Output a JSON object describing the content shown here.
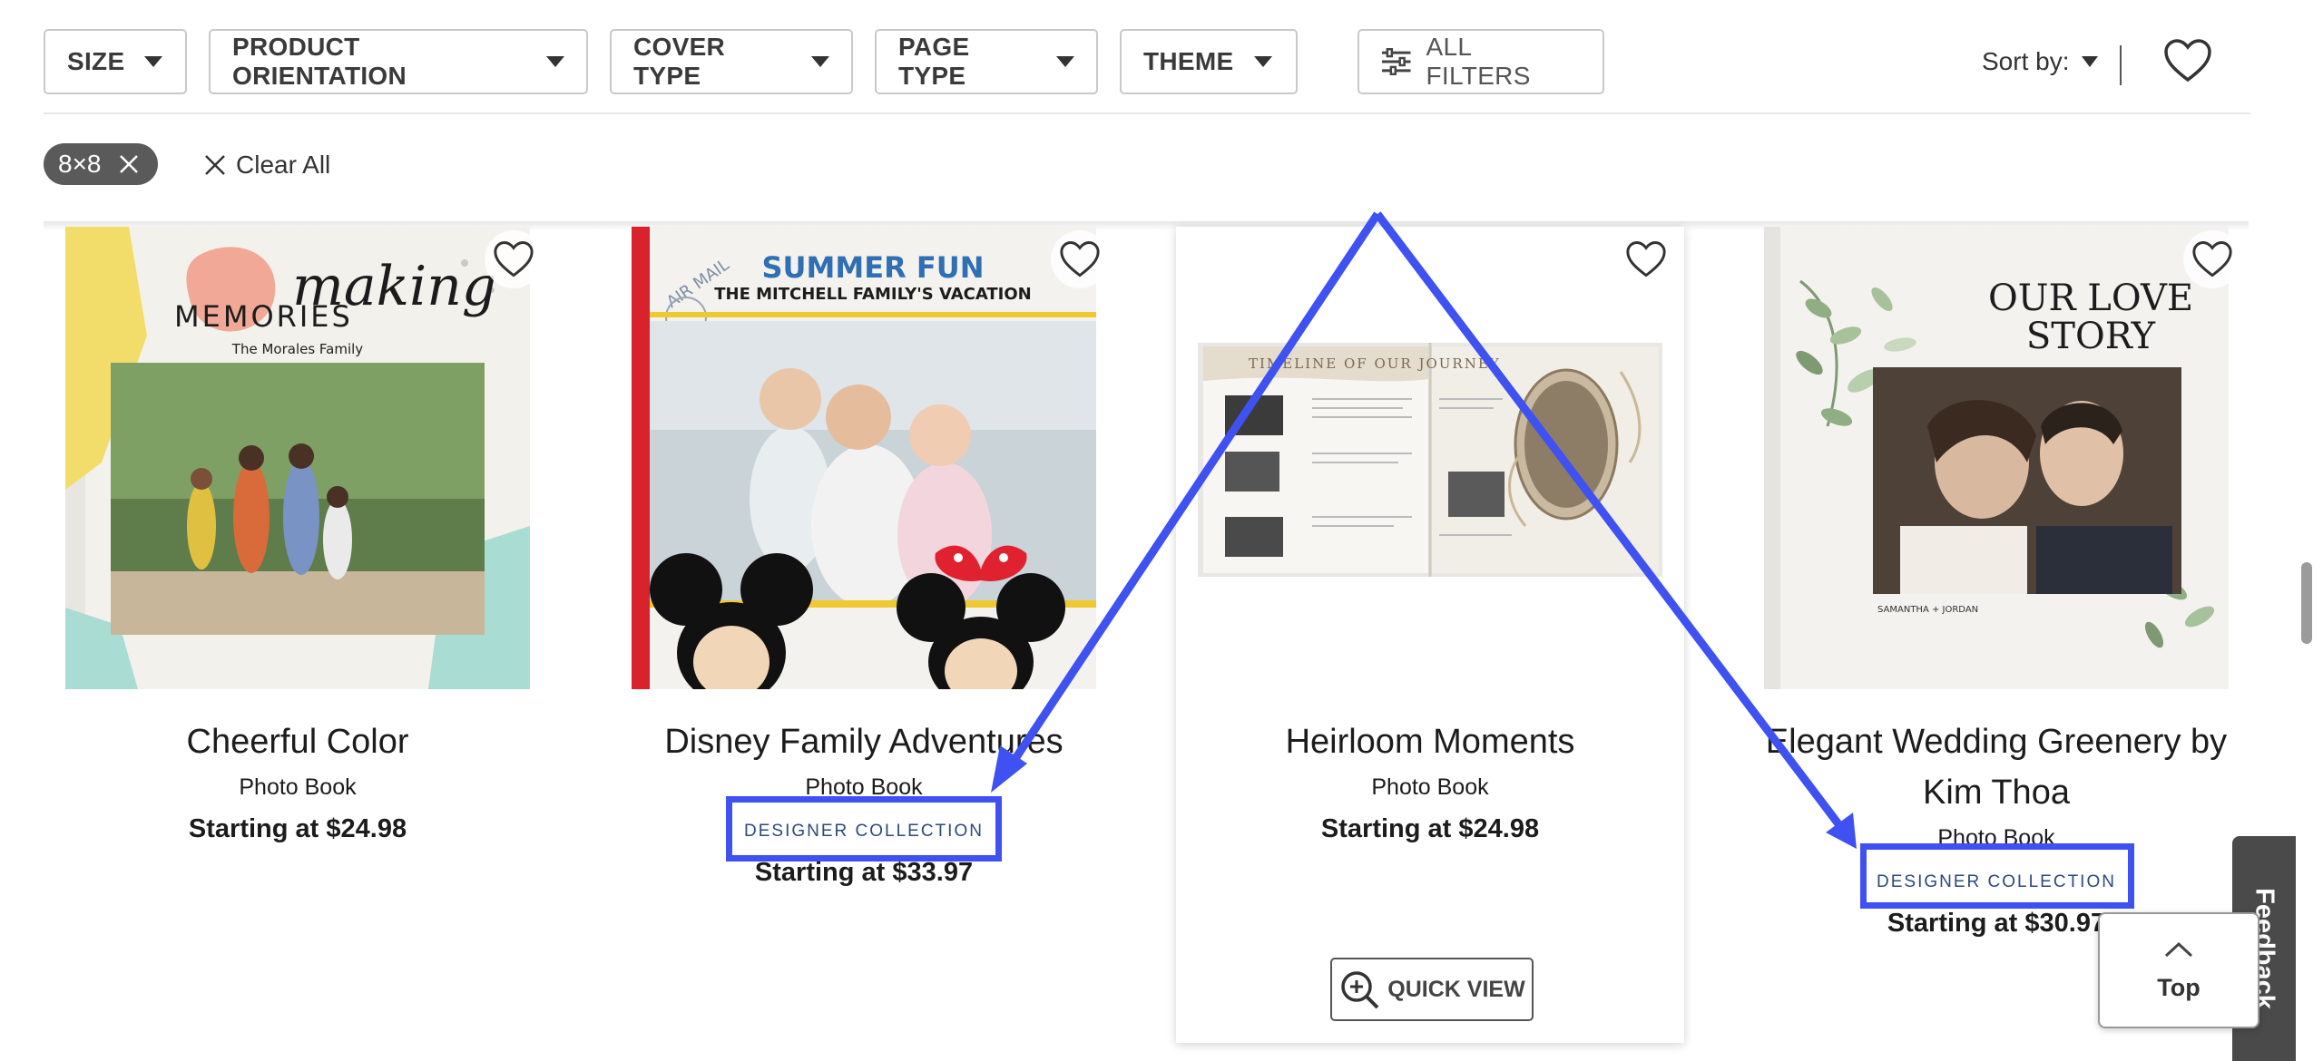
{
  "filters": [
    {
      "label": "SIZE"
    },
    {
      "label": "PRODUCT ORIENTATION"
    },
    {
      "label": "COVER TYPE"
    },
    {
      "label": "PAGE TYPE"
    },
    {
      "label": "THEME"
    }
  ],
  "all_filters_label": "ALL FILTERS",
  "sort_label": "Sort by:",
  "active_chip": "8×8",
  "clear_all_label": "Clear All",
  "products": [
    {
      "title": "Cheerful Color",
      "type": "Photo Book",
      "price": "Starting at $24.98",
      "cover": {
        "script": "making",
        "heading": "MEMORIES",
        "family": "The Morales Family"
      }
    },
    {
      "title": "Disney Family Adventures",
      "type": "Photo Book",
      "badge": "DESIGNER COLLECTION",
      "price": "Starting at $33.97",
      "cover": {
        "heading": "SUMMER FUN",
        "subheading": "THE MITCHELL FAMILY'S VACATION",
        "stamp": "AIR MAIL"
      }
    },
    {
      "title": "Heirloom Moments",
      "type": "Photo Book",
      "price": "Starting at $24.98",
      "quick_view": "QUICK VIEW",
      "cover": {
        "heading": "TIMELINE OF OUR JOURNEY"
      }
    },
    {
      "title": "Elegant Wedding Greenery by Kim Thoa",
      "type": "Photo Book",
      "badge": "DESIGNER COLLECTION",
      "price": "Starting at $30.97",
      "cover": {
        "heading_line1": "OUR LOVE",
        "heading_line2": "STORY",
        "names": "SAMANTHA + JORDAN"
      }
    }
  ],
  "top_label": "Top",
  "feedback_label": "Feedback",
  "colors": {
    "highlight": "#3f51f0",
    "badge_text": "#2b4a7d",
    "chip_bg": "#5a5a5a",
    "feedback_bg": "#4a4a4a"
  }
}
